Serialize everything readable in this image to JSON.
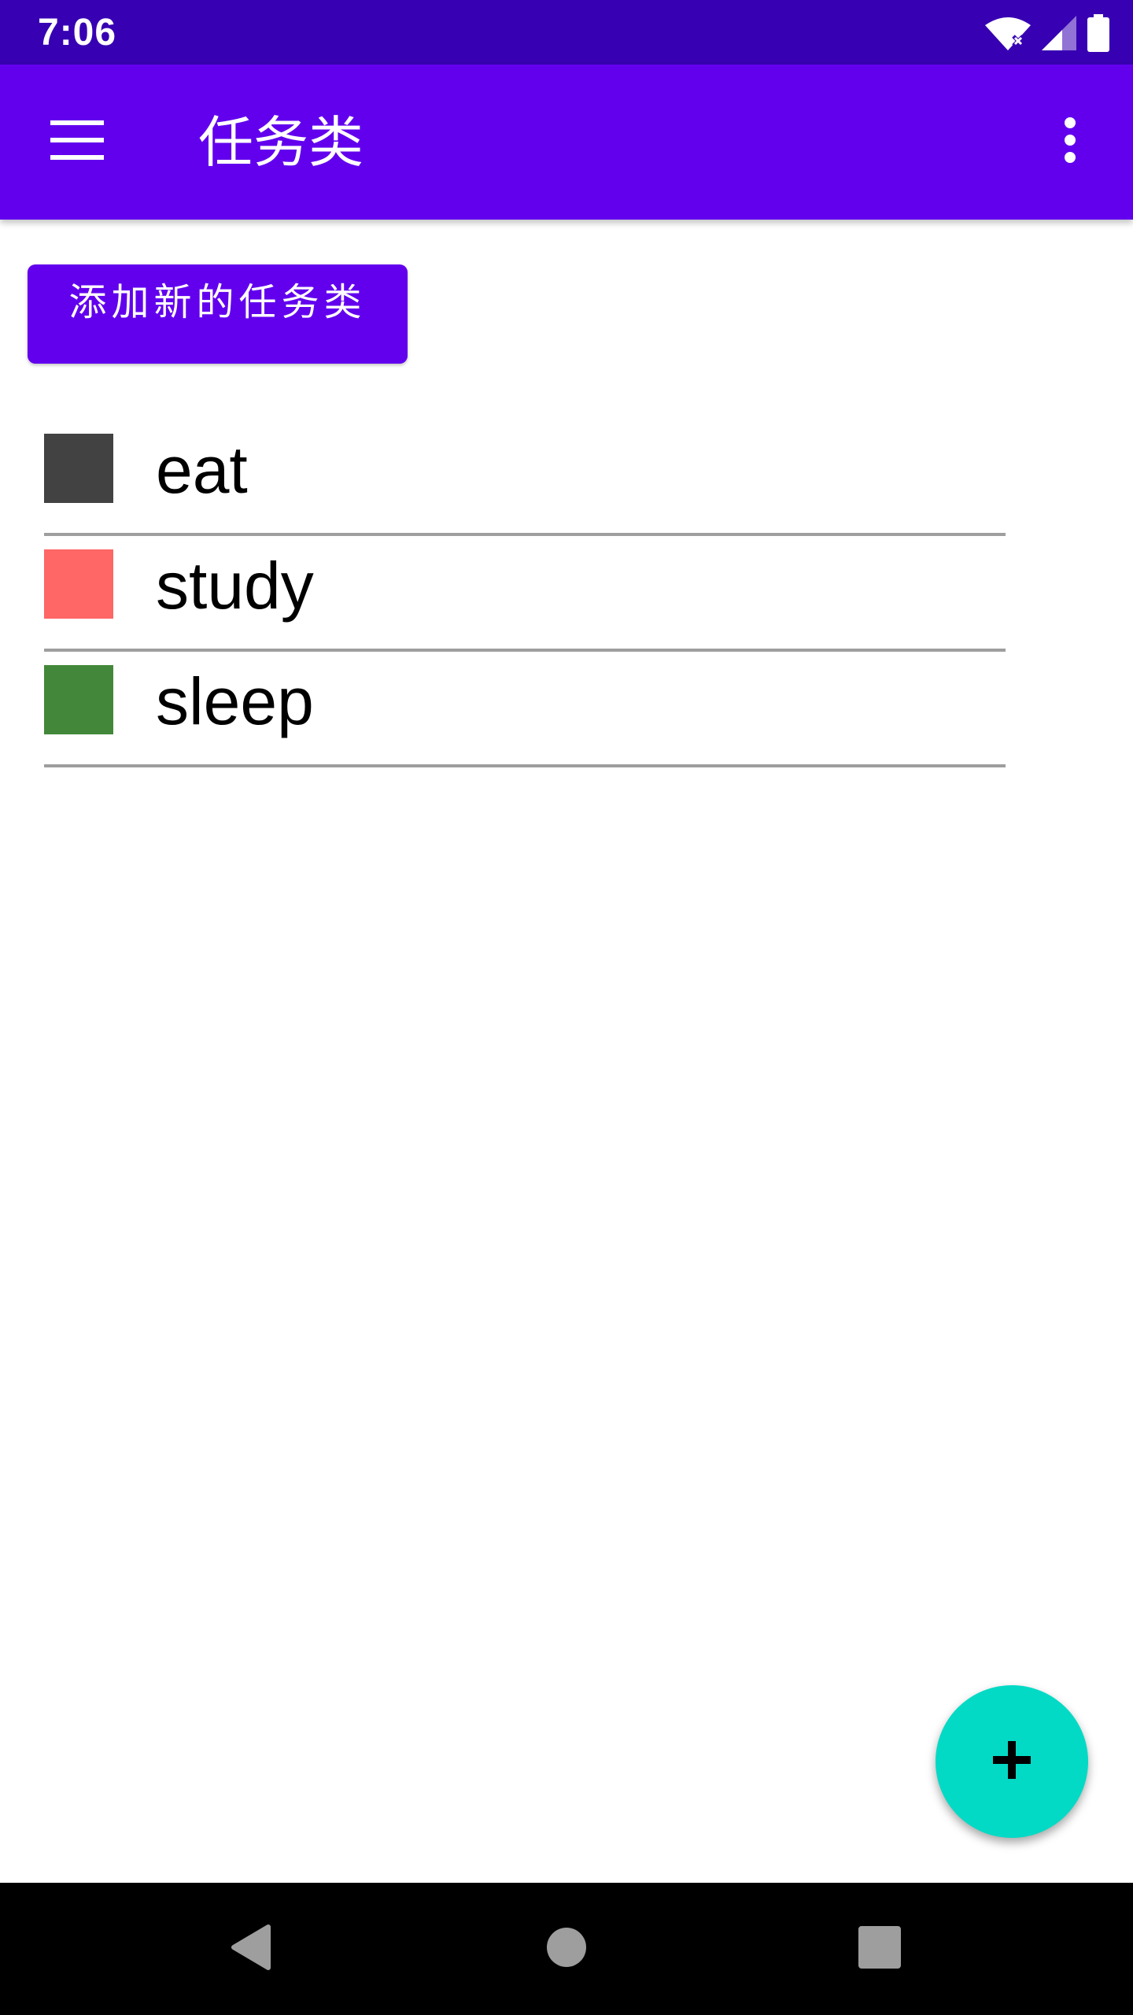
{
  "status_bar": {
    "time": "7:06",
    "icons": [
      "wifi-icon",
      "signal-icon",
      "battery-icon"
    ]
  },
  "app_bar": {
    "title": "任务类",
    "menu_icon": "menu-icon",
    "overflow_icon": "more-vert-icon",
    "background": "#6200ee"
  },
  "add_button": {
    "label": "添加新的任务类"
  },
  "categories": [
    {
      "name": "eat",
      "color": "#424242"
    },
    {
      "name": "study",
      "color": "#ff6666"
    },
    {
      "name": "sleep",
      "color": "#43883a"
    }
  ],
  "fab": {
    "icon": "plus-icon",
    "color": "#03dac5"
  },
  "nav_bar": {
    "icons": [
      "back-icon",
      "home-icon",
      "recents-icon"
    ]
  }
}
